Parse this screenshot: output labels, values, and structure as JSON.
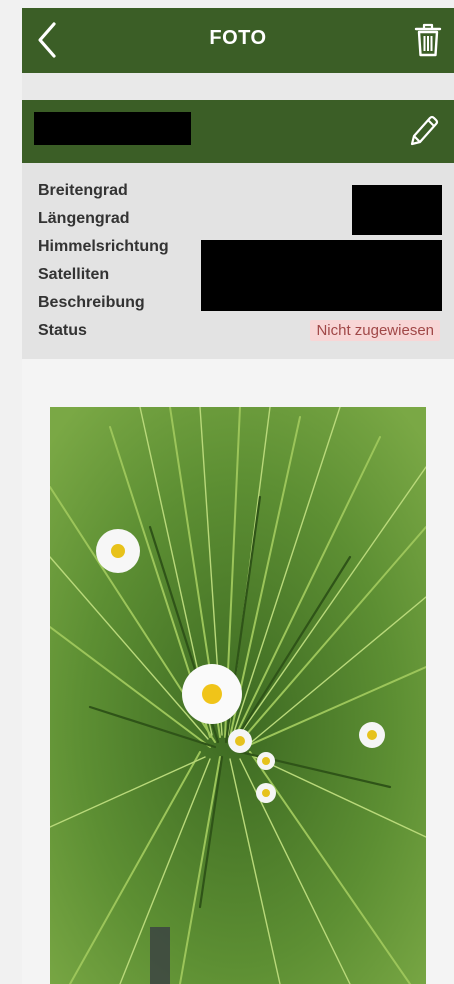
{
  "appbar": {
    "title": "FOTO",
    "back_icon": "chevron-left-icon",
    "delete_icon": "trash-icon"
  },
  "record": {
    "edit_icon": "pencil-icon"
  },
  "details": {
    "rows": [
      {
        "label": "Breitengrad"
      },
      {
        "label": "Längengrad"
      },
      {
        "label": "Himmelsrichtung"
      },
      {
        "label": "Satelliten"
      },
      {
        "label": "Beschreibung"
      },
      {
        "label": "Status",
        "value": "Nicht zugewiesen"
      }
    ]
  },
  "photo": {
    "subject": "meadow grass with daisies"
  },
  "colors": {
    "primary_green": "#3b5e26",
    "status_badge_bg": "#f8d6d6",
    "status_badge_text": "#a04848"
  }
}
